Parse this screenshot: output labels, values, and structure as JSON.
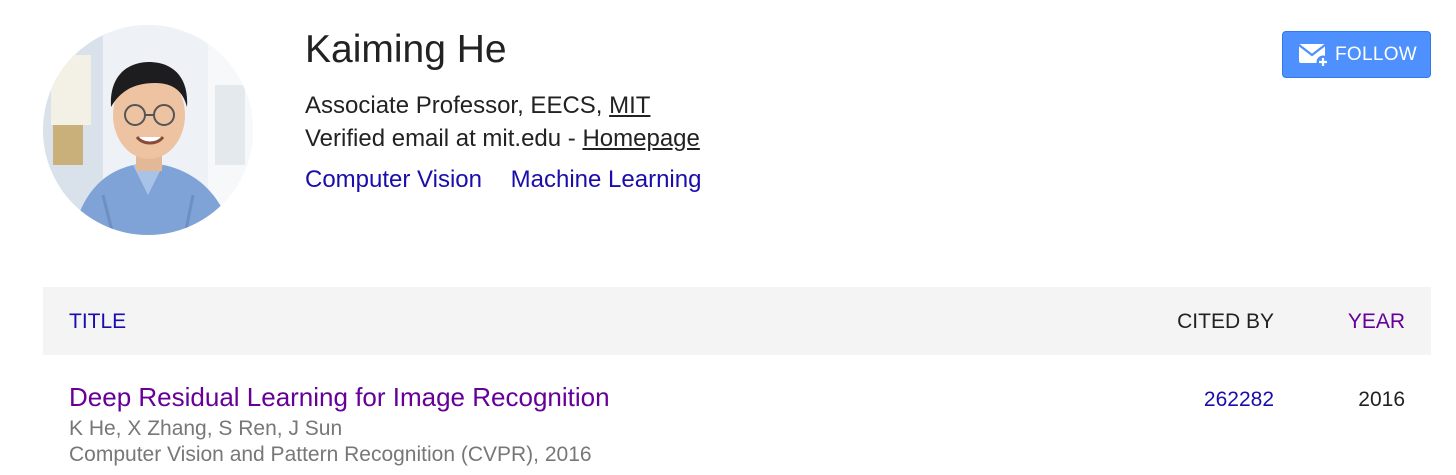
{
  "profile": {
    "name": "Kaiming He",
    "affiliation_prefix": "Associate Professor, EECS, ",
    "affiliation_link": "MIT",
    "email_prefix": "Verified email at mit.edu - ",
    "homepage_link": "Homepage",
    "interests": [
      "Computer Vision",
      "Machine Learning"
    ],
    "avatar_icon": "profile-photo"
  },
  "follow_button": {
    "label": "FOLLOW",
    "icon": "envelope-plus-icon",
    "color": "#4d90fe"
  },
  "table": {
    "headers": {
      "title": "TITLE",
      "cited_by": "CITED BY",
      "year": "YEAR"
    },
    "rows": [
      {
        "title": "Deep Residual Learning for Image Recognition",
        "authors": "K He, X Zhang, S Ren, J Sun",
        "venue": "Computer Vision and Pattern Recognition (CVPR), 2016",
        "cited_by": "262282",
        "year": "2016"
      }
    ]
  },
  "colors": {
    "link_blue": "#1a0dab",
    "visited_purple": "#660099",
    "header_bg": "#f4f4f4"
  }
}
